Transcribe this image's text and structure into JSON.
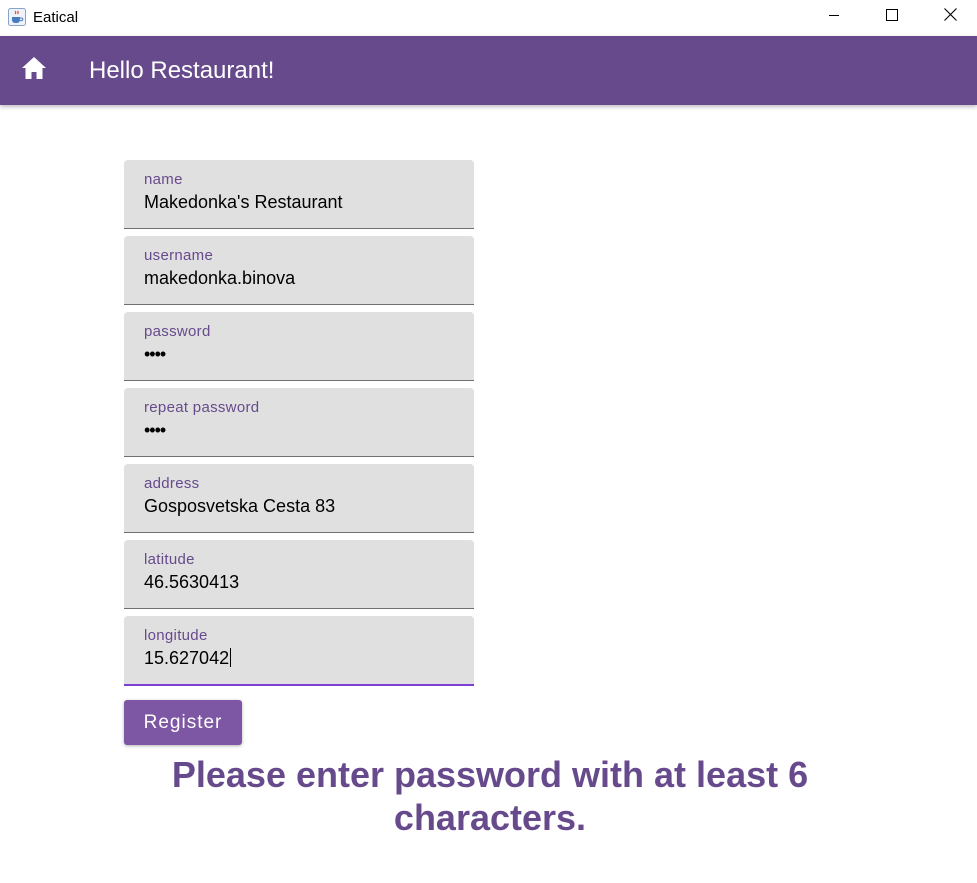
{
  "window": {
    "title": "Eatical",
    "app_icon": "java-cup-icon",
    "controls": [
      "minimize-icon",
      "maximize-icon",
      "close-icon"
    ]
  },
  "appbar": {
    "home_icon": "home-icon",
    "title": "Hello Restaurant!",
    "color": "#674a8c"
  },
  "form": {
    "fields": [
      {
        "label": "name",
        "value": "Makedonka's Restaurant"
      },
      {
        "label": "username",
        "value": "makedonka.binova"
      },
      {
        "label": "password",
        "value": "••••"
      },
      {
        "label": "repeat password",
        "value": "••••"
      },
      {
        "label": "address",
        "value": "Gosposvetska Cesta 83"
      },
      {
        "label": "latitude",
        "value": "46.5630413"
      },
      {
        "label": "longitude",
        "value": "15.627042"
      }
    ],
    "submit_label": "Register"
  },
  "error_message": "Please enter password with at least 6 characters.",
  "colors": {
    "accent": "#674a8c",
    "button": "#7e57a4",
    "field_bg": "#e0e0e0",
    "focus_underline": "#7b3fd1"
  }
}
